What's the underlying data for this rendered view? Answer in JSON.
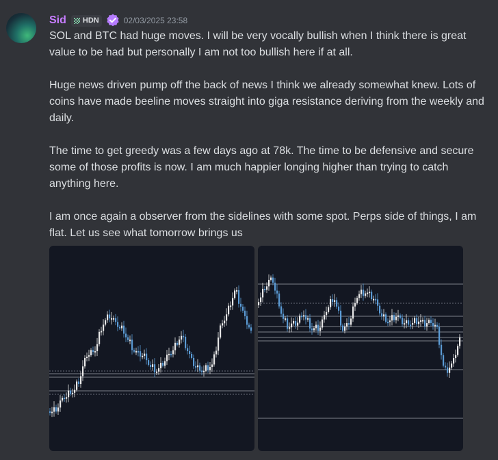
{
  "message": {
    "author": {
      "name": "Sid",
      "tag": "HDN",
      "name_color": "#c77dff"
    },
    "timestamp": "02/03/2025 23:58",
    "paragraphs": [
      "SOL and BTC had huge moves. I will be very vocally bullish when I think there is great value to be had but personally I am not too bullish here if at all.",
      "Huge news driven pump off the back of news I think we already somewhat knew. Lots of coins have made beeline moves straight into giga resistance deriving from the weekly and daily.",
      "The time to get greedy was a few days ago at 78k. The time to be defensive and secure some of those profits is now. I am much happier longing higher than trying to catch anything here.",
      "I am once again a observer from the sidelines with some spot. Perps side of things, I am flat. Let us see what tomorrow brings us"
    ],
    "attachments": [
      {
        "type": "chart-image",
        "icon": "candlestick-chart"
      },
      {
        "type": "chart-image",
        "icon": "candlestick-chart"
      }
    ]
  },
  "colors": {
    "background": "#313338",
    "text": "#dbdee1",
    "timestamp": "#949ba4",
    "chart_bg": "#131722",
    "candle_up": "#e8e8e8",
    "candle_down": "#5b9bd5"
  }
}
